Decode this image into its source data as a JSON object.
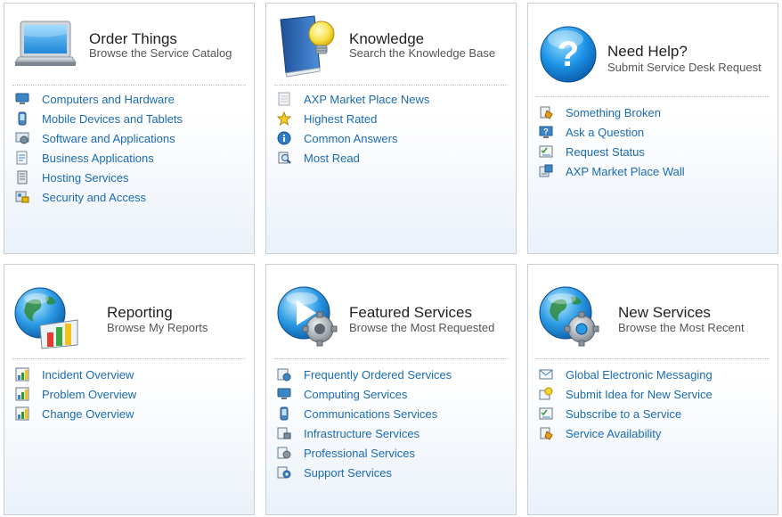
{
  "cards": [
    {
      "title": "Order Things",
      "subtitle": "Browse the Service Catalog",
      "hero_icon": "laptop-icon",
      "links": [
        {
          "label": "Computers and Hardware",
          "icon": "monitor-icon"
        },
        {
          "label": "Mobile Devices and Tablets",
          "icon": "mobile-phone-icon"
        },
        {
          "label": "Software and Applications",
          "icon": "software-icon"
        },
        {
          "label": "Business Applications",
          "icon": "business-app-icon"
        },
        {
          "label": "Hosting Services",
          "icon": "server-icon"
        },
        {
          "label": "Security and Access",
          "icon": "security-icon"
        }
      ]
    },
    {
      "title": "Knowledge",
      "subtitle": "Search the Knowledge Base",
      "hero_icon": "book-lightbulb-icon",
      "links": [
        {
          "label": "AXP Market Place News",
          "icon": "news-icon"
        },
        {
          "label": "Highest Rated",
          "icon": "star-icon"
        },
        {
          "label": "Common Answers",
          "icon": "info-icon"
        },
        {
          "label": "Most Read",
          "icon": "magnifier-doc-icon"
        }
      ]
    },
    {
      "title": "Need Help?",
      "subtitle": "Submit Service Desk Request",
      "hero_icon": "help-question-icon",
      "links": [
        {
          "label": "Something Broken",
          "icon": "broken-icon"
        },
        {
          "label": "Ask a Question",
          "icon": "question-screen-icon"
        },
        {
          "label": "Request Status",
          "icon": "checklist-icon"
        },
        {
          "label": "AXP Market Place Wall",
          "icon": "wall-icon"
        }
      ]
    },
    {
      "title": "Reporting",
      "subtitle": "Browse My Reports",
      "hero_icon": "globe-chart-icon",
      "links": [
        {
          "label": "Incident Overview",
          "icon": "bar-chart-icon"
        },
        {
          "label": "Problem Overview",
          "icon": "bar-chart-icon"
        },
        {
          "label": "Change Overview",
          "icon": "bar-chart-icon"
        }
      ]
    },
    {
      "title": "Featured Services",
      "subtitle": "Browse the Most Requested",
      "hero_icon": "play-gear-icon",
      "links": [
        {
          "label": "Frequently Ordered Services",
          "icon": "service-doc-icon"
        },
        {
          "label": "Computing Services",
          "icon": "monitor-icon"
        },
        {
          "label": "Communications Services",
          "icon": "mobile-phone-icon"
        },
        {
          "label": "Infrastructure Services",
          "icon": "infrastructure-icon"
        },
        {
          "label": "Professional Services",
          "icon": "professional-icon"
        },
        {
          "label": "Support Services",
          "icon": "support-icon"
        }
      ]
    },
    {
      "title": "New Services",
      "subtitle": "Browse the Most Recent",
      "hero_icon": "globe-gear-icon",
      "links": [
        {
          "label": "Global Electronic Messaging",
          "icon": "messaging-icon"
        },
        {
          "label": "Submit Idea for New Service",
          "icon": "idea-icon"
        },
        {
          "label": "Subscribe to a Service",
          "icon": "checklist-icon"
        },
        {
          "label": "Service Availability",
          "icon": "availability-icon"
        }
      ]
    }
  ]
}
